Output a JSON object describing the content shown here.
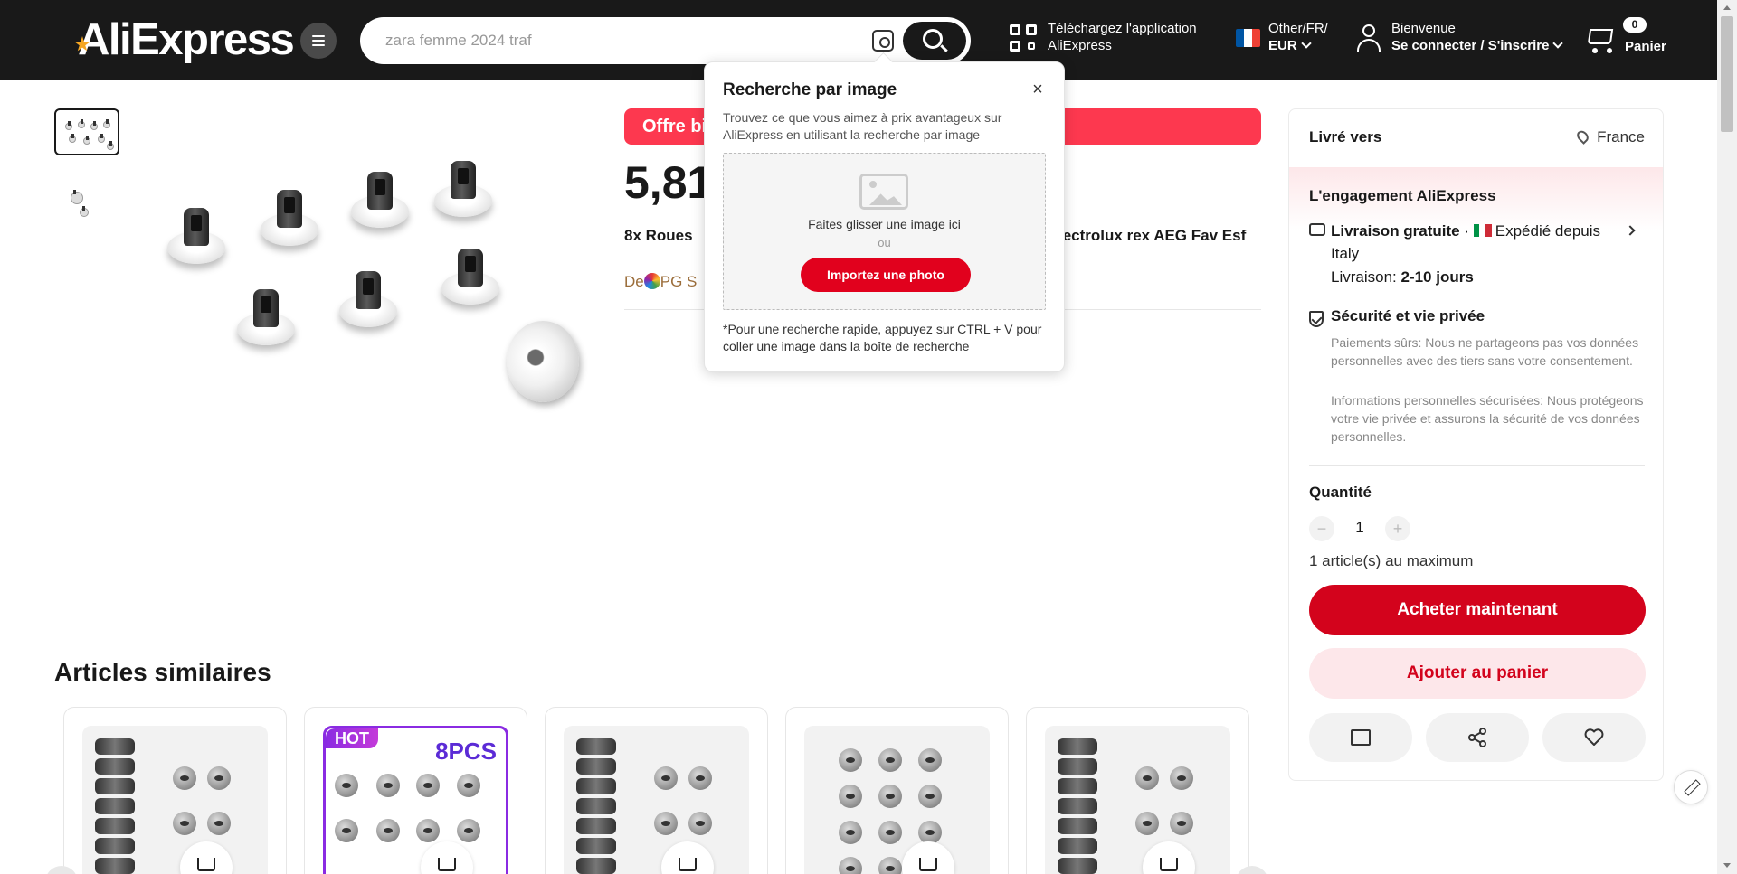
{
  "header": {
    "logo_text": "AliExpress",
    "search_placeholder": "zara femme 2024 traf",
    "app_line1": "Téléchargez l'application",
    "app_line2": "AliExpress",
    "locale_line1": "Other/FR/",
    "locale_line2": "EUR",
    "welcome": "Bienvenue",
    "signin": "Se connecter / S'inscrire",
    "cart_count": "0",
    "cart_label": "Panier",
    "icons": [
      "menu-icon",
      "camera-search-icon",
      "search-icon",
      "qr-code-icon",
      "france-flag-icon",
      "user-icon",
      "cart-icon"
    ]
  },
  "image_search_popup": {
    "title": "Recherche par image",
    "description": "Trouvez ce que vous aimez à prix avantageux sur AliExpress en utilisant la recherche par image",
    "drop_text": "Faites glisser une image ici",
    "or_text": "ou",
    "upload_label": "Importez une photo",
    "tip": "*Pour une recherche rapide, appuyez sur CTRL + V pour coller une image dans la boîte de recherche",
    "close_symbol": "×"
  },
  "product": {
    "offer_banner": "Offre bi",
    "price": "5,81",
    "title_start": "8x Roues ",
    "title_end": "lectrolux rex AEG Fav Esf",
    "store_prefix": "De",
    "store_suffix": "PG S"
  },
  "delivery_panel": {
    "ship_to_label": "Livré vers",
    "ship_to_value": "France",
    "engagement_title": "L'engagement AliExpress",
    "free_shipping": "Livraison gratuite",
    "separator": " · ",
    "shipped_from": "Expédié depuis Italy",
    "delivery_label": "Livraison: ",
    "delivery_value": "2-10 jours",
    "security_title": "Sécurité et vie privée",
    "security_p1": "Paiements sûrs: Nous ne partageons pas vos données personnelles avec des tiers sans votre consentement.",
    "security_p2": "Informations personnelles sécurisées: Nous protégeons votre vie privée et assurons la sécurité de vos données personnelles.",
    "quantity_label": "Quantité",
    "quantity_value": "1",
    "minus": "−",
    "plus": "+",
    "max_note": "1 article(s) au maximum",
    "buy_now": "Acheter maintenant",
    "add_to_cart": "Ajouter au panier",
    "action_icons": [
      "store-icon",
      "share-icon",
      "heart-icon"
    ]
  },
  "similar": {
    "title": "Articles similaires",
    "hot_badge": "HOT",
    "pcs_badge": "8PCS"
  },
  "colors": {
    "header_bg": "#191919",
    "brand_red": "#d3031c",
    "offer_red": "#fd384f"
  }
}
